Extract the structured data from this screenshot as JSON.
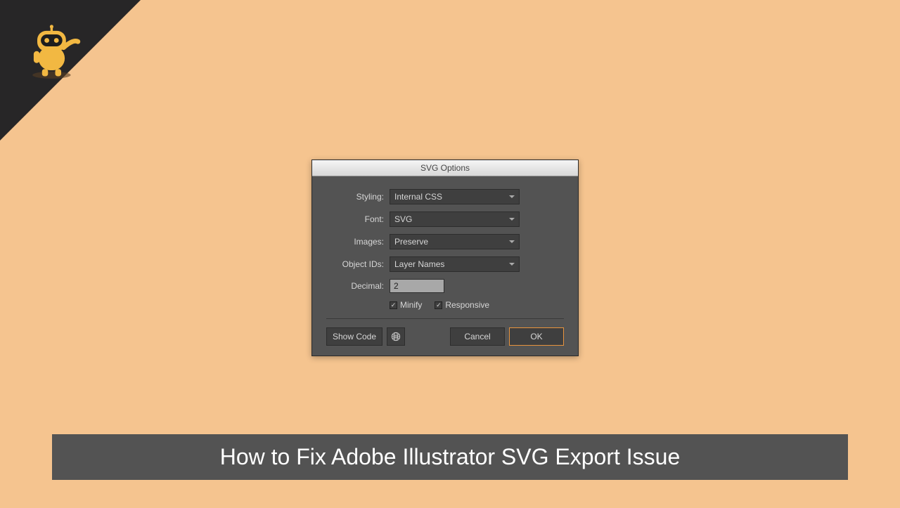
{
  "dialog": {
    "title": "SVG Options",
    "styling": {
      "label": "Styling:",
      "value": "Internal CSS"
    },
    "font": {
      "label": "Font:",
      "value": "SVG"
    },
    "images": {
      "label": "Images:",
      "value": "Preserve"
    },
    "objectIds": {
      "label": "Object IDs:",
      "value": "Layer Names"
    },
    "decimal": {
      "label": "Decimal:",
      "value": "2"
    },
    "minify": {
      "label": "Minify",
      "checked": true
    },
    "responsive": {
      "label": "Responsive",
      "checked": true
    },
    "buttons": {
      "showCode": "Show Code",
      "cancel": "Cancel",
      "ok": "OK"
    }
  },
  "caption": "How to Fix Adobe Illustrator SVG Export Issue"
}
